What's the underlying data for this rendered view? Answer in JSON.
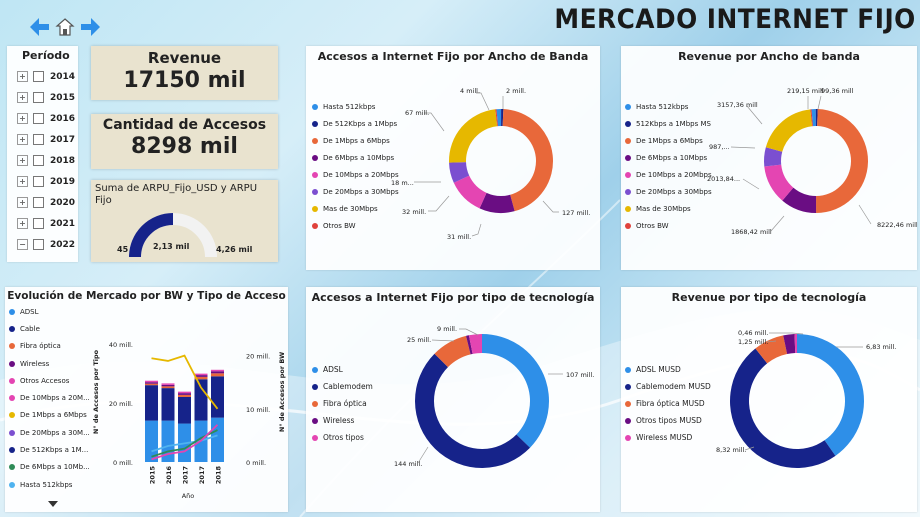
{
  "header": {
    "title": "MERCADO INTERNET FIJO"
  },
  "nav": {
    "back": "back",
    "home": "home",
    "forward": "forward"
  },
  "periodo": {
    "title": "Período",
    "years": [
      "2014",
      "2015",
      "2016",
      "2017",
      "2018",
      "2019",
      "2020",
      "2021",
      "2022"
    ],
    "expanded": "2022"
  },
  "kpis": {
    "revenue": {
      "label": "Revenue",
      "value": "17150 mil"
    },
    "accesos": {
      "label": "Cantidad de Accesos",
      "value": "8298 mil"
    },
    "arpu": {
      "label": "Suma de ARPU_Fijo_USD y ARPU Fijo",
      "min": "45",
      "value": "2,13 mil",
      "max": "4,26 mil",
      "fill": 0.5
    }
  },
  "colors": {
    "blue": "#2E8FE8",
    "navy": "#16238A",
    "orange": "#E8683A",
    "purple": "#6A0D83",
    "pink": "#E445B2",
    "violet": "#7B4FD0",
    "gold": "#E6B800",
    "red": "#E0423C",
    "green": "#2E8B57",
    "lightblue": "#4FB3F0"
  },
  "donut_bw_accesos": {
    "title": "Accesos a Internet Fijo por Ancho de Banda",
    "legend": [
      "Hasta 512kbps",
      "De 512Kbps a 1Mbps",
      "De 1Mbps a 6Mbps",
      "De 6Mbps a 10Mbps",
      "De 10Mbps a 20Mbps",
      "De 20Mbps a 30Mbps",
      "Mas de 30Mbps",
      "Otros BW"
    ],
    "labels": [
      "2 mill.",
      "4 mill.",
      "67 mill.",
      "18 m...",
      "32 mill.",
      "31 mill.",
      "127 mill."
    ]
  },
  "donut_bw_revenue": {
    "title": "Revenue por Ancho de banda",
    "legend": [
      "Hasta 512kbps",
      "512Kbps a 1Mbps MS",
      "De 1Mbps a 6Mbps",
      "De 6Mbps a 10Mbps",
      "De 10Mbps a 20Mbps",
      "De 20Mbps a 30Mbps",
      "Mas de 30Mbps",
      "Otros BW"
    ],
    "labels": [
      "219,15 mill",
      "99,36 mill",
      "3157,36 mill",
      "987,...",
      "2013,84...",
      "1868,42 mill",
      "8222,46 mill"
    ]
  },
  "evolucion": {
    "title": "Evolución de Mercado por BW y Tipo de Acceso",
    "legend": [
      "ADSL",
      "Cable",
      "Fibra óptica",
      "Wireless",
      "Otros Accesos",
      "De 10Mbps a 20M...",
      "De 1Mbps a 6Mbps",
      "De 20Mbps a 30M...",
      "De 512Kbps a 1M...",
      "De 6Mbps a 10Mb...",
      "Hasta 512kbps"
    ],
    "y_left_ticks": [
      "40 mill.",
      "20 mill.",
      "0 mill."
    ],
    "y_right_ticks": [
      "20 mill.",
      "10 mill.",
      "0 mill."
    ],
    "y_left_label": "N° de Accesos por Tipo",
    "y_right_label": "N° de Accesos por BW",
    "x_label": "Año",
    "x": [
      "2015",
      "2016",
      "2017",
      "2017",
      "2018"
    ]
  },
  "donut_tec_accesos": {
    "title": "Accesos a Internet Fijo por tipo de tecnología",
    "legend": [
      "ADSL",
      "Cablemodem",
      "Fibra óptica",
      "Wireless",
      "Otros tipos"
    ],
    "labels": [
      "9 mill.",
      "25 mill.",
      "107 mill.",
      "144 mill."
    ]
  },
  "donut_tec_revenue": {
    "title": "Revenue por tipo de tecnología",
    "legend": [
      "ADSL MUSD",
      "Cablemodem MUSD",
      "Fibra óptica MUSD",
      "Otros tipos MUSD",
      "Wireless MUSD"
    ],
    "labels": [
      "0,46 mill.",
      "1,25 mill.",
      "6,83 mill.",
      "8,32 mill."
    ]
  },
  "chart_data": [
    {
      "type": "pie",
      "title": "Accesos a Internet Fijo por Ancho de Banda",
      "unit": "mill.",
      "categories": [
        "Hasta 512kbps",
        "De 512Kbps a 1Mbps",
        "De 1Mbps a 6Mbps",
        "De 6Mbps a 10Mbps",
        "De 10Mbps a 20Mbps",
        "De 20Mbps a 30Mbps",
        "Mas de 30Mbps",
        "Otros BW"
      ],
      "values": [
        4,
        2,
        127,
        31,
        32,
        18,
        67,
        1
      ],
      "colors": [
        "#2E8FE8",
        "#16238A",
        "#E8683A",
        "#6A0D83",
        "#E445B2",
        "#7B4FD0",
        "#E6B800",
        "#E0423C"
      ]
    },
    {
      "type": "pie",
      "title": "Revenue por Ancho de banda",
      "unit": "mill",
      "categories": [
        "Hasta 512kbps",
        "512Kbps a 1Mbps MS",
        "De 1Mbps a 6Mbps",
        "De 6Mbps a 10Mbps",
        "De 10Mbps a 20Mbps",
        "De 20Mbps a 30Mbps",
        "Mas de 30Mbps",
        "Otros BW"
      ],
      "values": [
        219.15,
        99.36,
        8222.46,
        1868.42,
        2013.84,
        987,
        3157.36,
        60
      ],
      "colors": [
        "#2E8FE8",
        "#16238A",
        "#E8683A",
        "#6A0D83",
        "#E445B2",
        "#7B4FD0",
        "#E6B800",
        "#E0423C"
      ]
    },
    {
      "type": "pie",
      "title": "Accesos a Internet Fijo por tipo de tecnología",
      "unit": "mill.",
      "categories": [
        "ADSL",
        "Cablemodem",
        "Fibra óptica",
        "Wireless",
        "Otros tipos"
      ],
      "values": [
        107,
        144,
        25,
        2,
        9
      ],
      "colors": [
        "#2E8FE8",
        "#16238A",
        "#E8683A",
        "#6A0D83",
        "#E445B2"
      ]
    },
    {
      "type": "pie",
      "title": "Revenue por tipo de tecnología",
      "unit": "mill.",
      "categories": [
        "ADSL MUSD",
        "Cablemodem MUSD",
        "Fibra óptica MUSD",
        "Otros tipos MUSD",
        "Wireless MUSD"
      ],
      "values": [
        6.83,
        8.32,
        1.25,
        0.46,
        0.1
      ],
      "colors": [
        "#2E8FE8",
        "#16238A",
        "#E8683A",
        "#6A0D83",
        "#E445B2"
      ]
    },
    {
      "type": "bar",
      "title": "Evolución de Mercado por BW y Tipo de Acceso",
      "stacked": true,
      "categories": [
        "2015",
        "2016",
        "2017",
        "2017",
        "2018"
      ],
      "ylim": [
        0,
        45
      ],
      "y2lim": [
        0,
        25
      ],
      "series": [
        {
          "name": "ADSL",
          "values": [
            14,
            14,
            13,
            14,
            15
          ],
          "color": "#2E8FE8"
        },
        {
          "name": "Cable",
          "values": [
            12,
            11,
            9,
            14,
            14
          ],
          "color": "#16238A"
        },
        {
          "name": "Fibra óptica",
          "values": [
            0.5,
            0.6,
            0.7,
            0.8,
            1
          ],
          "color": "#E8683A"
        },
        {
          "name": "Wireless",
          "values": [
            0.5,
            0.5,
            0.6,
            0.6,
            0.7
          ],
          "color": "#6A0D83"
        },
        {
          "name": "Otros Accesos",
          "values": [
            0.5,
            0.5,
            0.5,
            0.5,
            0.5
          ],
          "color": "#E445B2"
        }
      ],
      "lines": [
        {
          "name": "De 1Mbps a 6Mbps",
          "values": [
            19.5,
            19,
            20,
            14,
            10
          ],
          "color": "#E6B800"
        },
        {
          "name": "Hasta 512kbps",
          "values": [
            2,
            3,
            3.5,
            4,
            5
          ],
          "color": "#4FB3F0"
        },
        {
          "name": "De 6Mbps a 10Mb...",
          "values": [
            1,
            2,
            2.5,
            4.5,
            6
          ],
          "color": "#2E8B57"
        },
        {
          "name": "De 10Mbps a 20M...",
          "values": [
            0.5,
            1.5,
            2,
            4,
            7
          ],
          "color": "#E445B2"
        }
      ]
    }
  ]
}
